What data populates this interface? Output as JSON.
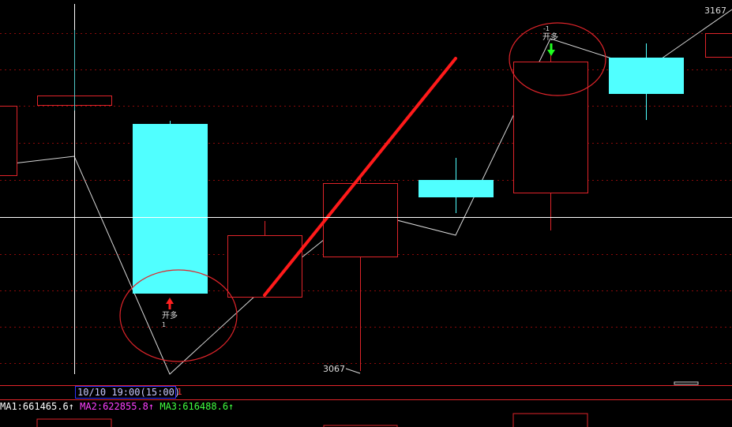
{
  "chart_data": {
    "type": "candlestick",
    "price_labels": {
      "low": "3067",
      "high": "3167"
    },
    "signals": [
      {
        "text": "开多",
        "sub": "1",
        "direction": "up"
      },
      {
        "text": "开多",
        "sub": "-1",
        "direction": "down"
      }
    ]
  },
  "status": {
    "time": "10/10 19:00(15:00)",
    "cursor": "1"
  },
  "indicators": [
    {
      "name": "MA1",
      "text": "MA1:661465.6",
      "arrow": "↑",
      "color": "#ffffff"
    },
    {
      "name": "MA2",
      "text": "MA2:622855.8",
      "arrow": "↑",
      "color": "#ff40ff"
    },
    {
      "name": "MA3",
      "text": "MA3:616488.6",
      "arrow": "↑",
      "color": "#40ff40"
    }
  ],
  "colors": {
    "background": "#000000",
    "bull": "#e0242a",
    "bear": "#50ffff",
    "grid": "#8a0a0a",
    "crosshair": "#ffffff",
    "trendline": "#ff1a1a"
  }
}
